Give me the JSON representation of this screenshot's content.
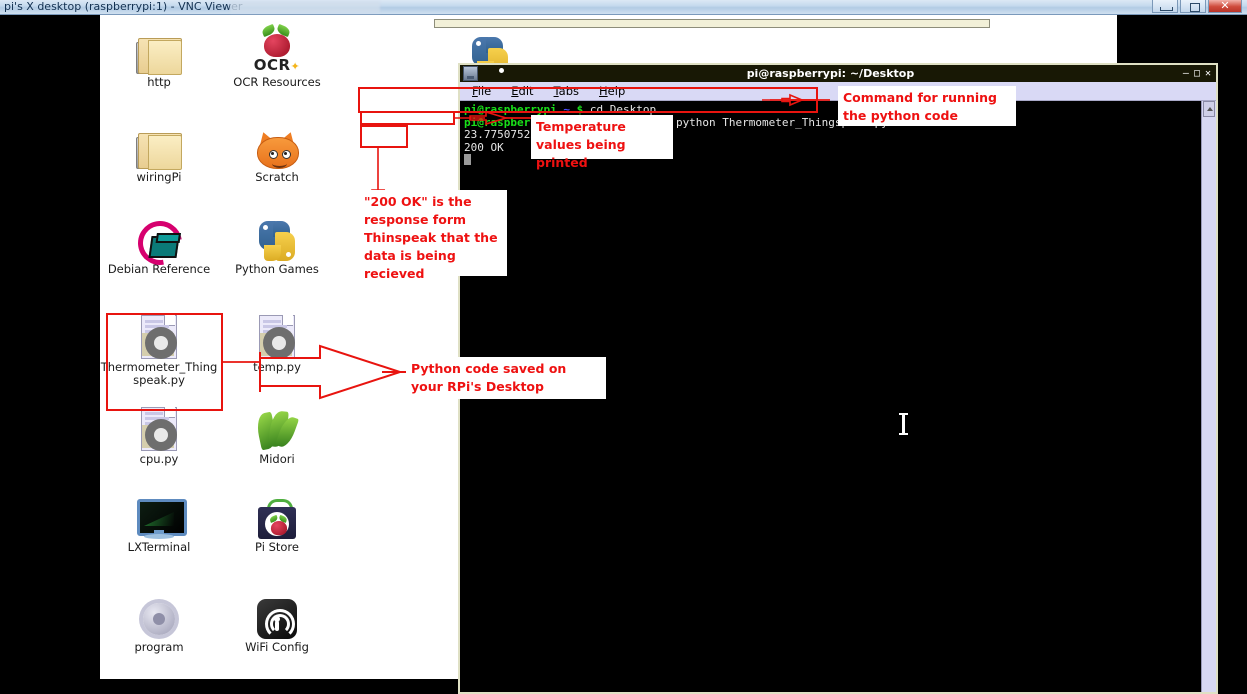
{
  "vnc": {
    "title": "pi's X desktop (raspberrypi:1) - VNC Viewer",
    "minimize_label": "–",
    "maximize_label": "□",
    "close_label": "✕"
  },
  "desktop": {
    "icons": [
      {
        "label": "http",
        "art": "folder"
      },
      {
        "label": "OCR Resources",
        "art": "ocr"
      },
      {
        "label": "wiringPi",
        "art": "folder"
      },
      {
        "label": "Scratch",
        "art": "scratch"
      },
      {
        "label": "Debian Reference",
        "art": "debian"
      },
      {
        "label": "Python Games",
        "art": "python"
      },
      {
        "label": "Thermometer_Thingspeak.py",
        "art": "pyfile"
      },
      {
        "label": "temp.py",
        "art": "pyfile"
      },
      {
        "label": "cpu.py",
        "art": "pyfile"
      },
      {
        "label": "Midori",
        "art": "midori"
      },
      {
        "label": "LXTerminal",
        "art": "monitor",
        "selected": true
      },
      {
        "label": "Pi Store",
        "art": "pistore"
      },
      {
        "label": "program",
        "art": "proggear"
      },
      {
        "label": "WiFi Config",
        "art": "wifi"
      }
    ],
    "ocr_text": "OCR",
    "ocr_star": "✦"
  },
  "terminal": {
    "title": "pi@raspberrypi: ~/Desktop",
    "buttons": {
      "minimize": "–",
      "maximize": "□",
      "close": "✕"
    },
    "menu": [
      {
        "accel": "F",
        "rest": "ile"
      },
      {
        "accel": "E",
        "rest": "dit"
      },
      {
        "accel": "T",
        "rest": "abs"
      },
      {
        "accel": "H",
        "rest": "elp"
      }
    ],
    "lines": [
      {
        "user": "pi@raspberrypi",
        "path": " ~ ",
        "prompt": "$ ",
        "cmd": "cd Desktop"
      },
      {
        "user": "pi@raspberrypi",
        "path": " ~/Desktop ",
        "prompt": "$ ",
        "cmd": "sudo python Thermometer_Thingspeak.py"
      }
    ],
    "output": [
      "23.7750752378",
      "200 OK"
    ]
  },
  "annotations": [
    {
      "name": "command-annotation",
      "text": "Command for running the python code"
    },
    {
      "name": "temperature-annotation",
      "text": "Temperature values being printed"
    },
    {
      "name": "response-annotation",
      "text": "\"200 OK\" is the response form Thinspeak that the data is being recieved"
    },
    {
      "name": "pyfile-annotation",
      "text": "Python code saved on your RPi's Desktop"
    }
  ],
  "colors": {
    "annotation_red": "#ee1111",
    "prompt_green": "#19e019",
    "path_blue": "#4c4cff",
    "selection_blue": "#5a7d99"
  }
}
